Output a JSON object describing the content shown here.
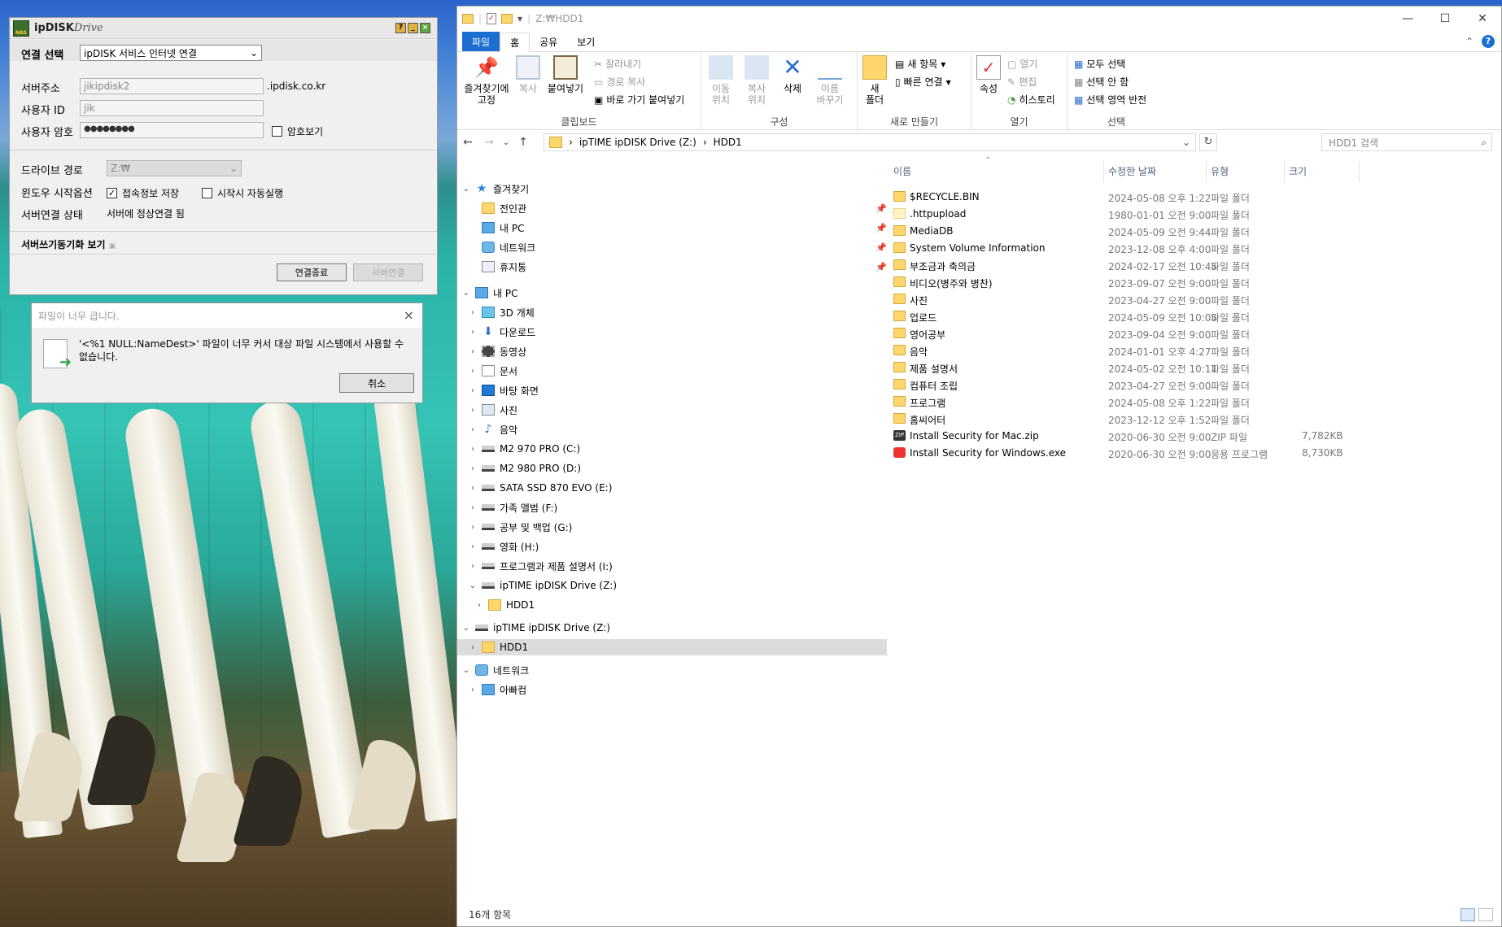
{
  "ipdisk": {
    "brand_bold": "ipDISK",
    "brand_light": "Drive",
    "logo_text": "NAS",
    "connect_label": "연결 선택",
    "connect_value": "ipDISK 서비스 인터넷 연결",
    "server_label": "서버주소",
    "server_value": "jikipdisk2",
    "server_suffix": ".ipdisk.co.kr",
    "user_label": "사용자 ID",
    "user_value": "jik",
    "pw_label": "사용자 암호",
    "pw_value": "●●●●●●●●",
    "show_pw": "암호보기",
    "drive_label": "드라이브 경로",
    "drive_value": "Z:₩",
    "win_start_label": "윈도우 시작옵션",
    "save_info": "접속정보 저장",
    "autorun": "시작시 자동실행",
    "status_label": "서버연결 상태",
    "status_value": "서버에 정상연결 됨",
    "sync_view": "서버쓰기동기화 보기",
    "btn_disconnect": "연결종료",
    "btn_connect": "서버연결"
  },
  "dialog": {
    "title": "파일이 너무 큽니다.",
    "message": "'<%1 NULL:NameDest>' 파일이 너무 커서 대상 파일 시스템에서 사용할 수 없습니다.",
    "cancel": "취소"
  },
  "explorer": {
    "title_path": "Z:₩HDD1",
    "tabs": [
      "파일",
      "홈",
      "공유",
      "보기"
    ],
    "ribbon": {
      "pin": "즐겨찾기에\n고정",
      "copy": "복사",
      "paste": "붙여넣기",
      "cut": "잘라내기",
      "copy_path": "경로 복사",
      "paste_shortcut": "바로 가기 붙여넣기",
      "clipboard": "클립보드",
      "move_to": "이동\n위치",
      "copy_to": "복사\n위치",
      "delete": "삭제",
      "rename": "이름\n바꾸기",
      "organize": "구성",
      "new_folder": "새\n폴더",
      "new_item": "새 항목",
      "easy_access": "빠른 연결",
      "new": "새로 만들기",
      "properties": "속성",
      "open": "열기",
      "edit": "편집",
      "history": "히스토리",
      "open_group": "열기",
      "select_all": "모두 선택",
      "select_none": "선택 안 함",
      "invert": "선택 영역 반전",
      "select": "선택"
    },
    "address": [
      "ipTIME ipDISK Drive (Z:)",
      "HDD1"
    ],
    "search_placeholder": "HDD1 검색",
    "tree": [
      {
        "label": "즐겨찾기",
        "icon": "star"
      },
      {
        "label": "전인관",
        "icon": "folder"
      },
      {
        "label": "내 PC",
        "icon": "pc"
      },
      {
        "label": "네트워크",
        "icon": "network"
      },
      {
        "label": "휴지통",
        "icon": "recycle"
      },
      {
        "label": "내 PC",
        "icon": "pc"
      },
      {
        "label": "3D 개체",
        "icon": "folder"
      },
      {
        "label": "다운로드",
        "icon": "download"
      },
      {
        "label": "동영상",
        "icon": "video"
      },
      {
        "label": "문서",
        "icon": "document"
      },
      {
        "label": "바탕 화면",
        "icon": "desktop"
      },
      {
        "label": "사진",
        "icon": "picture"
      },
      {
        "label": "음악",
        "icon": "music"
      },
      {
        "label": "M2 970 PRO (C:)",
        "icon": "drive"
      },
      {
        "label": "M2 980 PRO (D:)",
        "icon": "drive"
      },
      {
        "label": "SATA SSD 870 EVO (E:)",
        "icon": "drive"
      },
      {
        "label": "가족 앨범 (F:)",
        "icon": "drive"
      },
      {
        "label": "공부 및 백업 (G:)",
        "icon": "drive"
      },
      {
        "label": "영화 (H:)",
        "icon": "drive"
      },
      {
        "label": "프로그램과 제품 설명서 (I:)",
        "icon": "drive"
      },
      {
        "label": "ipTIME ipDISK Drive (Z:)",
        "icon": "drive"
      },
      {
        "label": "HDD1",
        "icon": "folder"
      },
      {
        "label": "ipTIME ipDISK Drive (Z:)",
        "icon": "drive"
      },
      {
        "label": "HDD1",
        "icon": "folder"
      },
      {
        "label": "네트워크",
        "icon": "network"
      },
      {
        "label": "아빠컴",
        "icon": "pc"
      }
    ],
    "columns": [
      "이름",
      "수정한 날짜",
      "유형",
      "크기"
    ],
    "files": [
      {
        "name": "$RECYCLE.BIN",
        "date": "2024-05-08 오후 1:22",
        "type": "파일 폴더",
        "size": "",
        "icon": "folder"
      },
      {
        "name": ".httpupload",
        "date": "1980-01-01 오전 9:00",
        "type": "파일 폴더",
        "size": "",
        "icon": "folder-light"
      },
      {
        "name": "MediaDB",
        "date": "2024-05-09 오전 9:44",
        "type": "파일 폴더",
        "size": "",
        "icon": "folder"
      },
      {
        "name": "System Volume Information",
        "date": "2023-12-08 오후 4:00",
        "type": "파일 폴더",
        "size": "",
        "icon": "folder"
      },
      {
        "name": "부조금과 축의금",
        "date": "2024-02-17 오전 10:45",
        "type": "파일 폴더",
        "size": "",
        "icon": "folder"
      },
      {
        "name": "비디오(병주와 병찬)",
        "date": "2023-09-07 오전 9:00",
        "type": "파일 폴더",
        "size": "",
        "icon": "folder"
      },
      {
        "name": "사진",
        "date": "2023-04-27 오전 9:00",
        "type": "파일 폴더",
        "size": "",
        "icon": "folder"
      },
      {
        "name": "업로드",
        "date": "2024-05-09 오전 10:05",
        "type": "파일 폴더",
        "size": "",
        "icon": "folder"
      },
      {
        "name": "영어공부",
        "date": "2023-09-04 오전 9:00",
        "type": "파일 폴더",
        "size": "",
        "icon": "folder"
      },
      {
        "name": "음악",
        "date": "2024-01-01 오후 4:27",
        "type": "파일 폴더",
        "size": "",
        "icon": "folder"
      },
      {
        "name": "제품 설명서",
        "date": "2024-05-02 오전 10:11",
        "type": "파일 폴더",
        "size": "",
        "icon": "folder"
      },
      {
        "name": "컴퓨터 조립",
        "date": "2023-04-27 오전 9:00",
        "type": "파일 폴더",
        "size": "",
        "icon": "folder"
      },
      {
        "name": "프로그램",
        "date": "2024-05-08 오후 1:22",
        "type": "파일 폴더",
        "size": "",
        "icon": "folder"
      },
      {
        "name": "홈씨어터",
        "date": "2023-12-12 오후 1:52",
        "type": "파일 폴더",
        "size": "",
        "icon": "folder"
      },
      {
        "name": "Install Security for Mac.zip",
        "date": "2020-06-30 오전 9:00",
        "type": "ZIP 파일",
        "size": "7,782KB",
        "icon": "zip"
      },
      {
        "name": "Install Security for Windows.exe",
        "date": "2020-06-30 오전 9:00",
        "type": "응용 프로그램",
        "size": "8,730KB",
        "icon": "exe"
      }
    ],
    "status_text": "16개 항목"
  }
}
